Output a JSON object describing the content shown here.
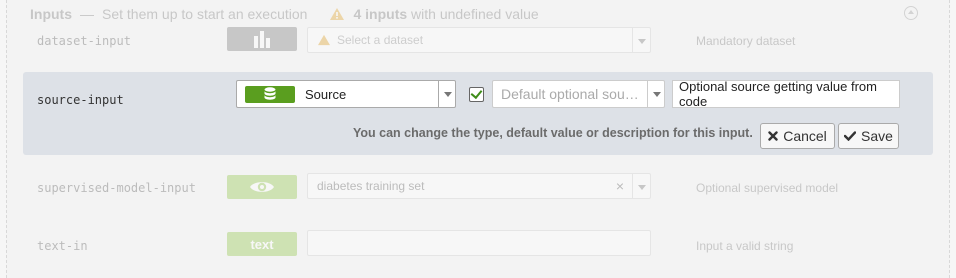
{
  "header": {
    "title": "Inputs",
    "dash": "—",
    "subtitle": "Set them up to start an execution",
    "warning_count": "4 inputs",
    "warning_text": "with undefined value"
  },
  "rows": {
    "dataset": {
      "name": "dataset-input",
      "select_placeholder": "Select a dataset",
      "description": "Mandatory dataset"
    },
    "source": {
      "name": "source-input",
      "type_label": "Source",
      "default_placeholder": "Default optional sou…",
      "description_value": "Optional source getting value from code",
      "hint": "You can change the type, default value or description for this input.",
      "cancel_label": "Cancel",
      "save_label": "Save"
    },
    "supervised": {
      "name": "supervised-model-input",
      "select_value": "diabetes training set",
      "clear_glyph": "×",
      "description": "Optional supervised model"
    },
    "text": {
      "name": "text-in",
      "type_label": "text",
      "description": "Input a valid string"
    }
  },
  "colors": {
    "accent_green": "#5a9e1f",
    "active_bg": "#dde1e7",
    "warning": "#e0a020"
  }
}
